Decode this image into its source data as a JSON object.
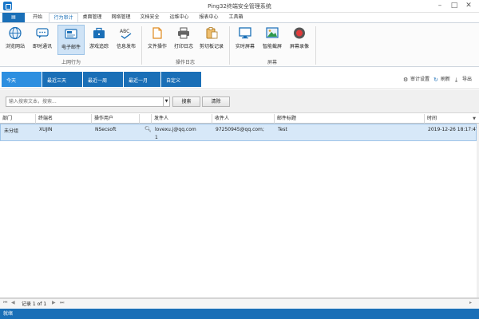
{
  "window": {
    "title": "Ping32终端安全管理系统",
    "min_icon": "minimize-icon",
    "max_icon": "maximize-icon",
    "close_icon": "close-icon"
  },
  "ribbon_tabs": {
    "file": "▤",
    "items": [
      "开始",
      "行为审计",
      "桌面管理",
      "网络管理",
      "文档安全",
      "运维中心",
      "报表中心",
      "工具箱"
    ],
    "active": "行为审计"
  },
  "ribbon": {
    "groups": [
      {
        "label": "上网行为",
        "buttons": [
          {
            "label": "浏览网站",
            "icon": "globe-icon"
          },
          {
            "label": "即时通讯",
            "icon": "chat-icon"
          },
          {
            "label": "电子邮件",
            "icon": "mail-icon",
            "selected": true
          },
          {
            "label": "游戏追踪",
            "icon": "briefcase-icon"
          },
          {
            "label": "信息发布",
            "icon": "abc-icon"
          }
        ]
      },
      {
        "label": "操作日志",
        "buttons": [
          {
            "label": "文件操作",
            "icon": "file-icon"
          },
          {
            "label": "打印日志",
            "icon": "printer-icon"
          },
          {
            "label": "剪切板记录",
            "icon": "clipboard-icon"
          }
        ]
      },
      {
        "label": "屏幕",
        "buttons": [
          {
            "label": "实时屏幕",
            "icon": "monitor-icon"
          },
          {
            "label": "智能截屏",
            "icon": "screenshot-icon"
          },
          {
            "label": "屏幕录像",
            "icon": "record-icon"
          }
        ]
      }
    ]
  },
  "filters": {
    "tabs": [
      "今天",
      "最近三天",
      "最近一周",
      "最近一月",
      "自定义"
    ],
    "active": "今天",
    "actions": {
      "audit_settings": "审计设置",
      "refresh": "刷新",
      "export": "导出"
    }
  },
  "search": {
    "placeholder": "输入搜索文本，搜索...",
    "search_button": "搜索",
    "clear_button": "清除"
  },
  "grid": {
    "columns": [
      "部门",
      "终端名",
      "操作用户",
      "",
      "发件人",
      "收件人",
      "邮件标题",
      "时间"
    ],
    "rows": [
      {
        "dept": "未分组",
        "terminal": "XUJIN",
        "user": "NSecsoft",
        "attach_count": "1",
        "sender": "lovexu.j@qq.com",
        "recipient": "97250945@qq.com;",
        "subject": "Test",
        "time": "2019-12-26 18:17:47"
      }
    ]
  },
  "pager": {
    "text": "记录 1 of 1"
  },
  "status": {
    "text": "就绪"
  },
  "colors": {
    "accent": "#1a6fb7",
    "selected_row": "#d7e8f8"
  }
}
